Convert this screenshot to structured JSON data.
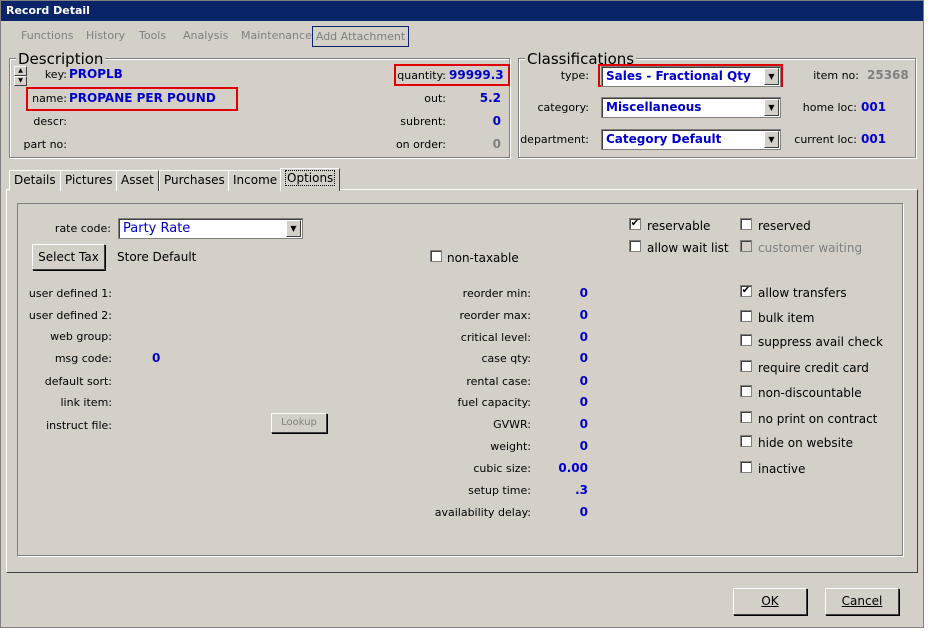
{
  "window": {
    "title": "Record Detail"
  },
  "menu": {
    "items": [
      "Functions",
      "History",
      "Tools",
      "Analysis",
      "Maintenance"
    ],
    "add_attachment": "Add Attachment"
  },
  "description": {
    "title": "Description",
    "key_label": "key:",
    "key_value": "PROPLB",
    "name_label": "name:",
    "name_value": "PROPANE PER POUND",
    "descr_label": "descr:",
    "partno_label": "part no:",
    "quantity_label": "quantity:",
    "quantity_value": "99999.3",
    "out_label": "out:",
    "out_value": "5.2",
    "subrent_label": "subrent:",
    "subrent_value": "0",
    "onorder_label": "on order:",
    "onorder_value": "0"
  },
  "classifications": {
    "title": "Classifications",
    "type_label": "type:",
    "type_value": "Sales - Fractional Qty",
    "category_label": "category:",
    "category_value": "Miscellaneous",
    "department_label": "department:",
    "department_value": "Category Default",
    "itemno_label": "item no:",
    "itemno_value": "25368",
    "homeloc_label": "home loc:",
    "homeloc_value": "001",
    "currentloc_label": "current loc:",
    "currentloc_value": "001"
  },
  "tabs": [
    "Details",
    "Pictures",
    "Asset",
    "Purchases",
    "Income",
    "Options"
  ],
  "options": {
    "rate_code_label": "rate code:",
    "rate_code_value": "Party Rate",
    "select_tax_button": "Select Tax",
    "tax_value": "Store Default",
    "non_taxable_label": "non-taxable",
    "left_labels": {
      "user_defined_1": "user defined 1:",
      "user_defined_2": "user defined 2:",
      "web_group": "web group:",
      "msg_code": "msg code:",
      "default_sort": "default sort:",
      "link_item": "link item:",
      "instruct_file": "instruct file:"
    },
    "msg_code_value": "0",
    "lookup_button": "Lookup",
    "mid_fields": [
      {
        "label": "reorder min:",
        "value": "0"
      },
      {
        "label": "reorder max:",
        "value": "0"
      },
      {
        "label": "critical level:",
        "value": "0"
      },
      {
        "label": "case qty:",
        "value": "0"
      },
      {
        "label": "rental case:",
        "value": "0"
      },
      {
        "label": "fuel capacity:",
        "value": "0"
      },
      {
        "label": "GVWR:",
        "value": "0"
      },
      {
        "label": "weight:",
        "value": "0"
      },
      {
        "label": "cubic size:",
        "value": "0.00"
      },
      {
        "label": "setup time:",
        "value": ".3"
      },
      {
        "label": "availability delay:",
        "value": "0"
      }
    ],
    "checks": {
      "reservable": {
        "label": "reservable",
        "checked": true
      },
      "allow_wait_list": {
        "label": "allow wait list",
        "checked": false
      },
      "reserved": {
        "label": "reserved",
        "checked": false
      },
      "customer_waiting": {
        "label": "customer waiting",
        "checked": false
      },
      "allow_transfers": {
        "label": "allow transfers",
        "checked": true
      },
      "bulk_item": {
        "label": "bulk item",
        "checked": false
      },
      "suppress_avail_check": {
        "label": "suppress avail check",
        "checked": false
      },
      "require_credit_card": {
        "label": "require credit card",
        "checked": false
      },
      "non_discountable": {
        "label": "non-discountable",
        "checked": false
      },
      "no_print_on_contract": {
        "label": "no print on contract",
        "checked": false
      },
      "hide_on_website": {
        "label": "hide on website",
        "checked": false
      },
      "inactive": {
        "label": "inactive",
        "checked": false
      }
    }
  },
  "footer": {
    "ok": "OK",
    "cancel": "Cancel"
  },
  "colors": {
    "title_bar": "#0a246a",
    "value_blue": "#0000cc",
    "highlight_red": "#e00000",
    "face": "#d4d0c8"
  }
}
